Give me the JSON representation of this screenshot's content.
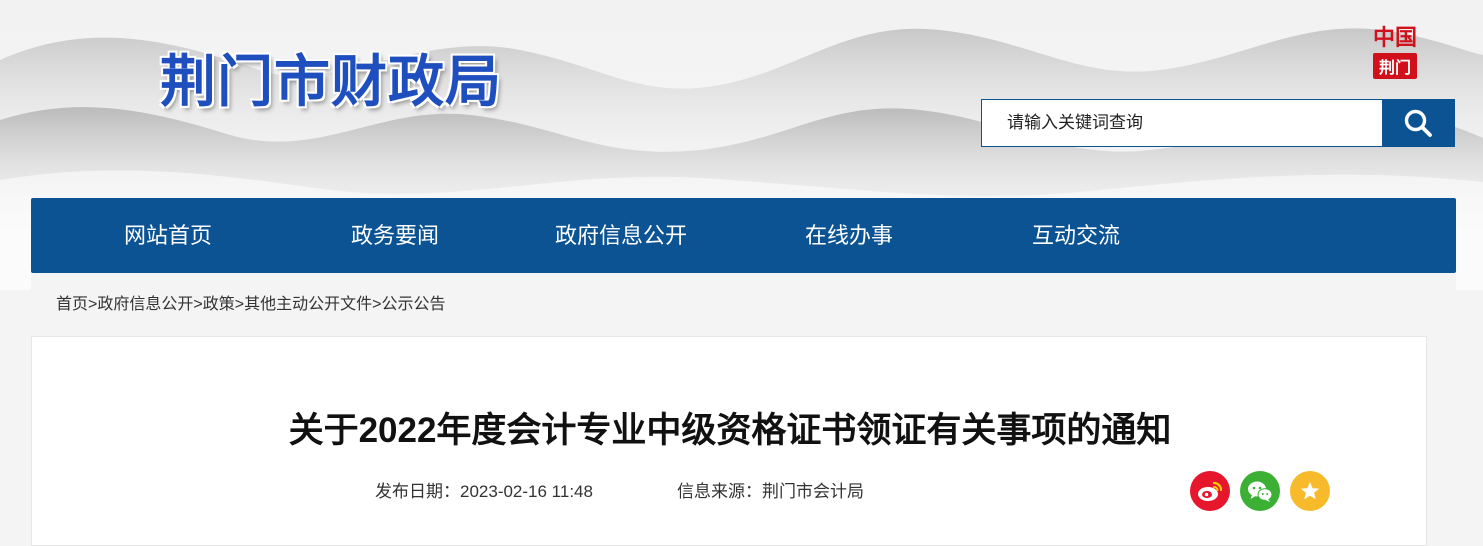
{
  "site": {
    "title": "荆门市财政局"
  },
  "emblem": {
    "top_text": "中国",
    "bottom_text": "荆门"
  },
  "search": {
    "placeholder": "请输入关键词查询",
    "icon": "search-icon"
  },
  "nav": {
    "items": [
      {
        "label": "网站首页"
      },
      {
        "label": "政务要闻"
      },
      {
        "label": "政府信息公开"
      },
      {
        "label": "在线办事"
      },
      {
        "label": "互动交流"
      }
    ]
  },
  "breadcrumb": {
    "separator": ">",
    "items": [
      "首页",
      "政府信息公开",
      "政策",
      "其他主动公开文件",
      "公示公告"
    ]
  },
  "article": {
    "title": "关于2022年度会计专业中级资格证书领证有关事项的通知",
    "publish_date": "发布日期：2023-02-16 11:48",
    "source": "信息来源：荆门市会计局"
  },
  "share": [
    {
      "icon": "weibo-icon",
      "color": "#e6162d"
    },
    {
      "icon": "wechat-icon",
      "color": "#3cb034"
    },
    {
      "icon": "favorite-star-icon",
      "color": "#f7ba2a"
    }
  ],
  "colors": {
    "primary": "#0c5393",
    "title_blue": "#1f4fbf",
    "seal_red": "#d0111b"
  }
}
